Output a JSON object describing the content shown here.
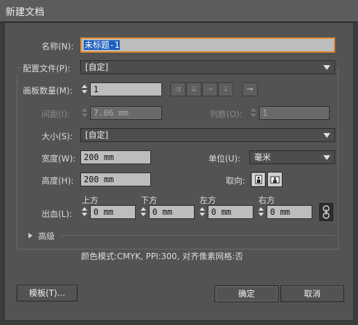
{
  "window": {
    "title": "新建文档"
  },
  "name": {
    "label": "名称(N):",
    "value": "未标题-1"
  },
  "profile": {
    "label": "配置文件(P):",
    "value": "[自定]"
  },
  "artboards": {
    "label": "画板数量(M):",
    "value": "1"
  },
  "spacing": {
    "label": "间距(I):",
    "value": "7.06 mm"
  },
  "columns": {
    "label": "列数(O):",
    "value": "1"
  },
  "size": {
    "label": "大小(S):",
    "value": "[自定]"
  },
  "width": {
    "label": "宽度(W):",
    "value": "200 mm"
  },
  "units": {
    "label": "单位(U):",
    "value": "毫米"
  },
  "height": {
    "label": "高度(H):",
    "value": "200 mm"
  },
  "orientation": {
    "label": "取向:"
  },
  "bleed": {
    "label": "出血(L):",
    "top": {
      "label": "上方",
      "value": "0 mm"
    },
    "bottom": {
      "label": "下方",
      "value": "0 mm"
    },
    "left": {
      "label": "左方",
      "value": "0 mm"
    },
    "right": {
      "label": "右方",
      "value": "0 mm"
    }
  },
  "advanced": {
    "label": "高级"
  },
  "summary": "颜色模式:CMYK, PPI:300, 对齐像素网格:否",
  "buttons": {
    "templates": "模板(T)...",
    "ok": "确定",
    "cancel": "取消"
  },
  "colors": {
    "focus": "#e08a2e",
    "selection": "#1f5fbf"
  }
}
